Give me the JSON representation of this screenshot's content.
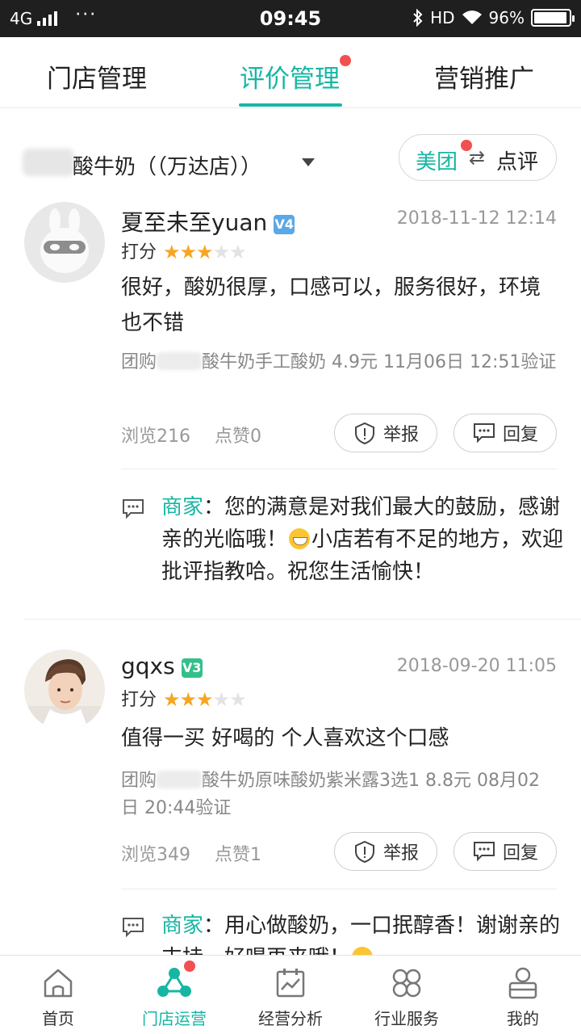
{
  "status_bar": {
    "network": "4G",
    "dots": "···",
    "time": "09:45",
    "hd": "HD",
    "battery": "96%",
    "battery_level": 0.96
  },
  "tabs": [
    {
      "label": "门店管理",
      "active": false
    },
    {
      "label": "评价管理",
      "active": true,
      "badge": true
    },
    {
      "label": "营销推广",
      "active": false
    }
  ],
  "store": {
    "name": "酸牛奶（（万达店））",
    "switch_left": "美团",
    "switch_arrows": "⇄",
    "switch_right": "点评"
  },
  "reviews": [
    {
      "username": "夏至未至yuan",
      "level": "V4",
      "datetime": "2018-11-12 12:14",
      "rating_label": "打分",
      "stars": 3,
      "stars_total": 5,
      "text": "很好，酸奶很厚，口感可以，服务很好，环境也不错",
      "deal_prefix": "团购",
      "deal_text": "酸牛奶手工酸奶 4.9元  11月06日 12:51验证",
      "views": "浏览216",
      "likes": "点赞0",
      "report_label": "举报",
      "reply_label": "回复",
      "merchant_label": "商家",
      "merchant_reply_1": "：您的满意是对我们最大的鼓励，感谢亲的光临哦！",
      "merchant_reply_2": "小店若有不足的地方，欢迎批评指教哈。祝您生活愉快！"
    },
    {
      "username": "gqxs",
      "level": "V3",
      "datetime": "2018-09-20 11:05",
      "rating_label": "打分",
      "stars": 3,
      "stars_total": 5,
      "text": "值得一买 好喝的 个人喜欢这个口感",
      "deal_prefix": "团购",
      "deal_text": "酸牛奶原味酸奶紫米露3选1 8.8元  08月02日 20:44验证",
      "views": "浏览349",
      "likes": "点赞1",
      "report_label": "举报",
      "reply_label": "回复",
      "merchant_label": "商家",
      "merchant_reply_1": "：用心做酸奶，一口抿醇香！谢谢亲的支持，好喝再来哦！",
      "merchant_reply_2": ""
    }
  ],
  "bottom_nav": [
    {
      "label": "首页",
      "icon": "home-icon"
    },
    {
      "label": "门店运营",
      "icon": "store-ops-icon",
      "active": true,
      "badge": true
    },
    {
      "label": "经营分析",
      "icon": "analysis-icon"
    },
    {
      "label": "行业服务",
      "icon": "industry-icon"
    },
    {
      "label": "我的",
      "icon": "profile-icon"
    }
  ],
  "colors": {
    "accent": "#17b6a3",
    "star": "#f6a623",
    "badge": "#f25050"
  }
}
